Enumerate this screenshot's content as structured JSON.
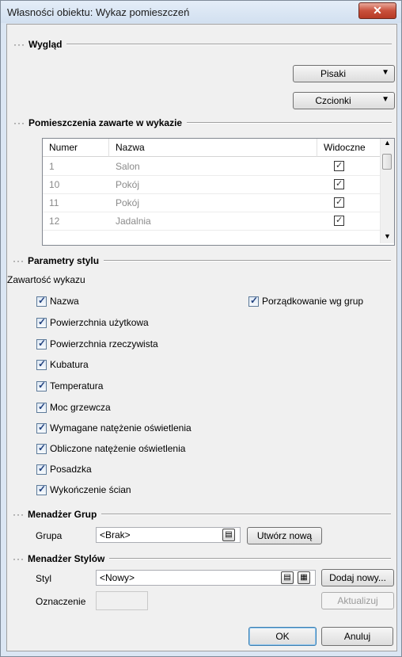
{
  "window": {
    "title": "Własności obiektu: Wykaz pomieszczeń",
    "close": "✕"
  },
  "sections": {
    "wyglad": "Wygląd",
    "pomieszczenia": "Pomieszczenia zawarte w wykazie",
    "parametry": "Parametry stylu",
    "menadzer_grup": "Menadżer Grup",
    "menadzer_stylow": "Menadżer Stylów"
  },
  "wyglad": {
    "pisaki": "Pisaki",
    "czcionki": "Czcionki"
  },
  "table": {
    "columns": [
      "Numer",
      "Nazwa",
      "Widoczne"
    ],
    "rows": [
      {
        "numer": "1",
        "nazwa": "Salon",
        "widoczne": true
      },
      {
        "numer": "10",
        "nazwa": "Pokój",
        "widoczne": true
      },
      {
        "numer": "11",
        "nazwa": "Pokój",
        "widoczne": true
      },
      {
        "numer": "12",
        "nazwa": "Jadalnia",
        "widoczne": true
      }
    ]
  },
  "parametry": {
    "zawartosc_label": "Zawartość wykazu",
    "options": [
      "Nazwa",
      "Powierzchnia użytkowa",
      "Powierzchnia rzeczywista",
      "Kubatura",
      "Temperatura",
      "Moc grzewcza",
      "Wymagane natężenie oświetlenia",
      "Obliczone natężenie oświetlenia",
      "Posadzka",
      "Wykończenie ścian"
    ],
    "porzadkowanie": "Porządkowanie wg grup"
  },
  "grupy": {
    "label": "Grupa",
    "value": "<Brak>",
    "new_button": "Utwórz nową"
  },
  "style": {
    "styl_label": "Styl",
    "styl_value": "<Nowy>",
    "dodaj_button": "Dodaj nowy...",
    "oznaczenie_label": "Oznaczenie",
    "oznaczenie_value": "",
    "aktualizuj_button": "Aktualizuj"
  },
  "footer": {
    "ok": "OK",
    "cancel": "Anuluj"
  }
}
